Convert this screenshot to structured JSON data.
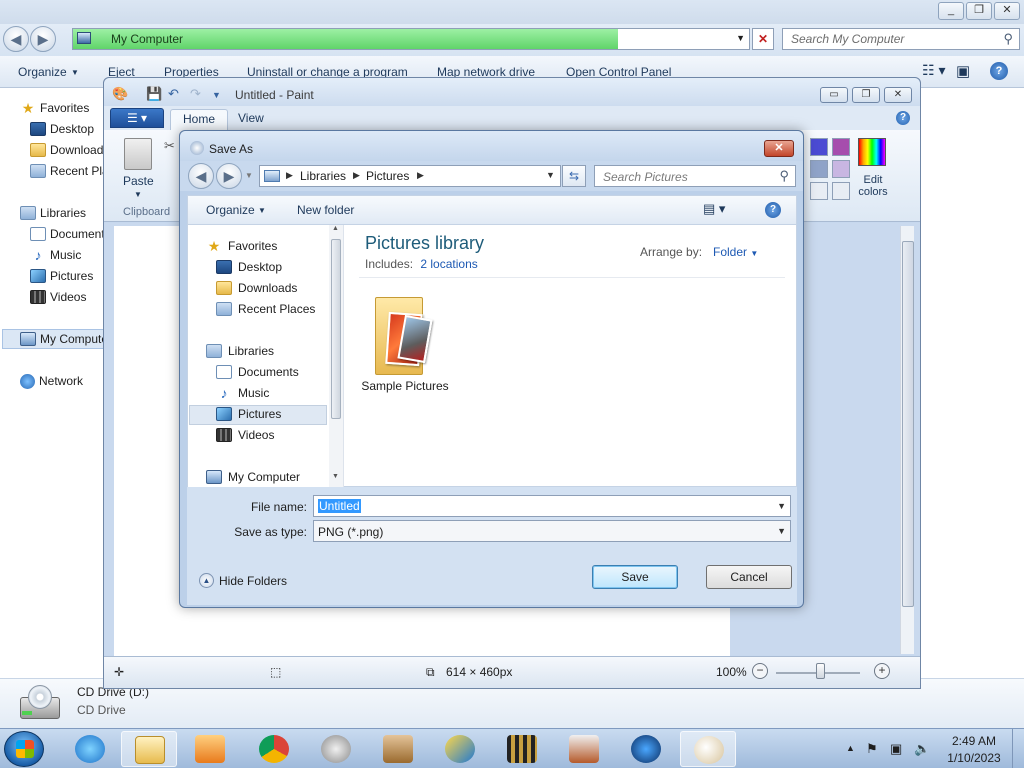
{
  "explorer": {
    "address": "My Computer",
    "search_placeholder": "Search My Computer",
    "toolbar": [
      "Organize",
      "Eject",
      "Properties",
      "Uninstall or change a program",
      "Map network drive",
      "Open Control Panel"
    ],
    "sidebar": {
      "favorites": "Favorites",
      "desktop": "Desktop",
      "downloads": "Downloads",
      "recent": "Recent Places",
      "libraries": "Libraries",
      "documents": "Documents",
      "music": "Music",
      "pictures": "Pictures",
      "videos": "Videos",
      "mycomputer": "My Computer",
      "network": "Network"
    },
    "details": {
      "name": "CD Drive (D:)",
      "type": "CD Drive"
    }
  },
  "paint": {
    "title": "Untitled - Paint",
    "tabs": {
      "home": "Home",
      "view": "View"
    },
    "paste": "Paste",
    "clipboard": "Clipboard",
    "edit_colors": "Edit colors",
    "swatches": [
      "#4b4bd3",
      "#a64dad",
      "#8fa3c8",
      "#c8b6e2",
      "#e8edf4",
      "#e8edf4"
    ],
    "status_size": "614 × 460px",
    "zoom": "100%"
  },
  "saveas": {
    "title": "Save As",
    "breadcrumb": [
      "Libraries",
      "Pictures"
    ],
    "search_placeholder": "Search Pictures",
    "organize": "Organize",
    "new_folder": "New folder",
    "nav": {
      "favorites": "Favorites",
      "desktop": "Desktop",
      "downloads": "Downloads",
      "recent": "Recent Places",
      "libraries": "Libraries",
      "documents": "Documents",
      "music": "Music",
      "pictures": "Pictures",
      "videos": "Videos",
      "mycomputer": "My Computer"
    },
    "library_title": "Pictures library",
    "includes_label": "Includes:",
    "includes_link": "2 locations",
    "arrange_label": "Arrange by:",
    "arrange_value": "Folder",
    "folder_name": "Sample Pictures",
    "filename_label": "File name:",
    "filename_value": "Untitled",
    "savetype_label": "Save as type:",
    "savetype_value": "PNG (*.png)",
    "hide_folders": "Hide Folders",
    "save": "Save",
    "cancel": "Cancel"
  },
  "taskbar": {
    "time": "2:49 AM",
    "date": "1/10/2023"
  }
}
